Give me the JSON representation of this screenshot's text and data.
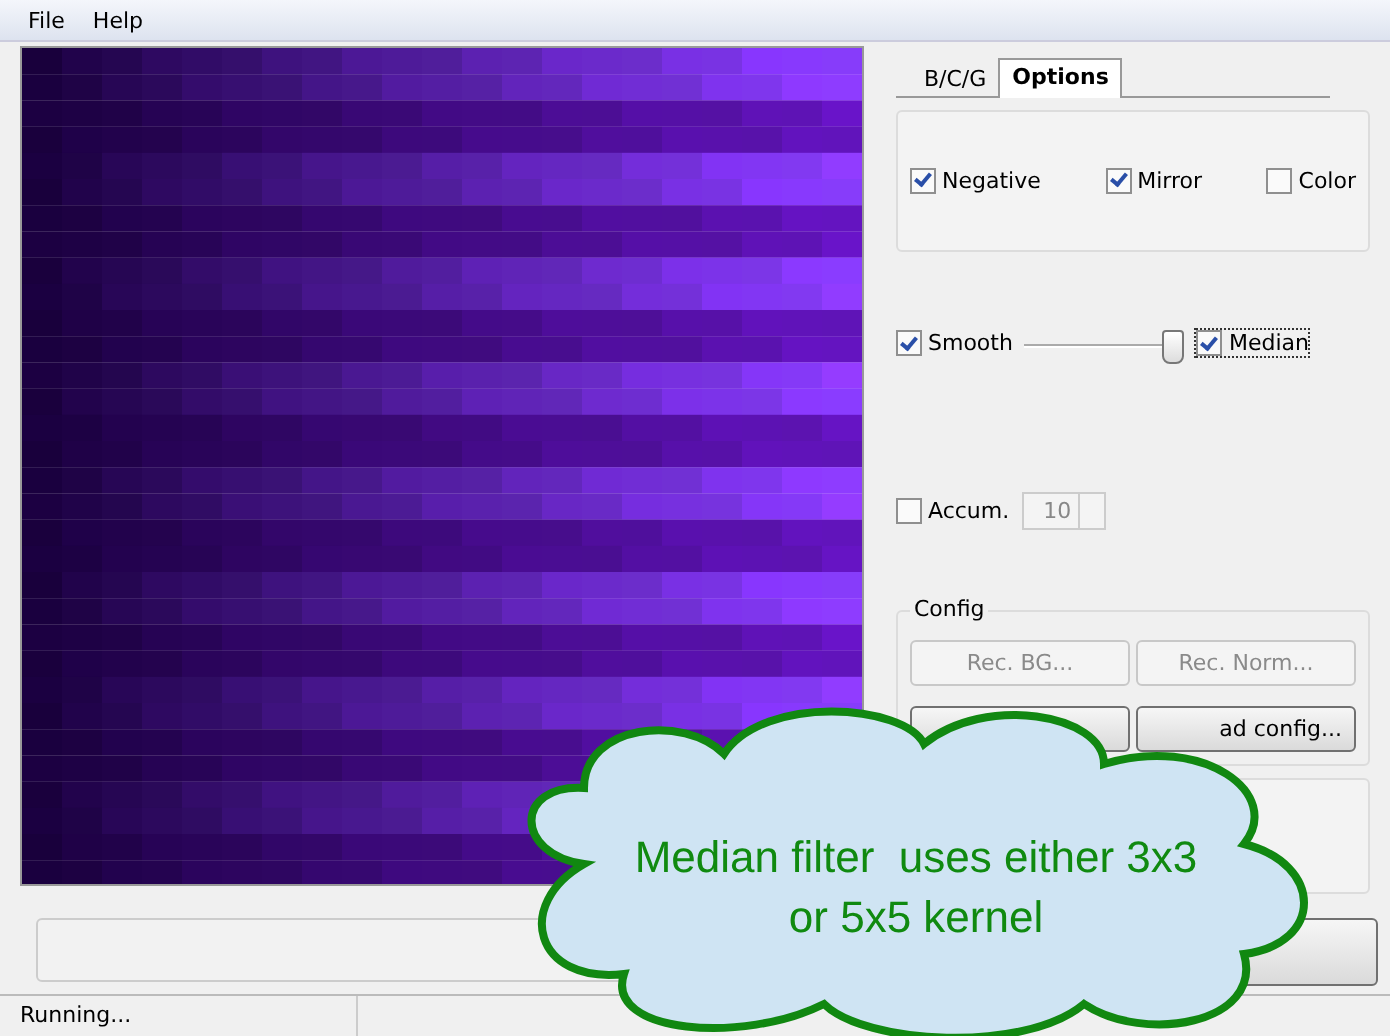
{
  "menu": [
    {
      "label": "File"
    },
    {
      "label": "Help"
    }
  ],
  "tabs": [
    {
      "label": "B/C/G",
      "selected": false
    },
    {
      "label": "Options",
      "selected": true
    }
  ],
  "options": [
    {
      "label": "Negative",
      "checked": true
    },
    {
      "label": "Mirror",
      "checked": true
    },
    {
      "label": "Color",
      "checked": false
    }
  ],
  "smooth": {
    "label": "Smooth",
    "checked": true,
    "level": 1.0
  },
  "median": {
    "label": "Median",
    "checked": true
  },
  "accum": {
    "label": "Accum.",
    "checked": false,
    "value": "10",
    "disabled": true
  },
  "config": {
    "title": "Config",
    "buttons": [
      {
        "label": "Rec. BG...",
        "disabled": true
      },
      {
        "label": "Rec. Norm...",
        "disabled": true
      },
      {
        "label": "ad config...",
        "disabled": false
      }
    ]
  },
  "callout": {
    "lines": [
      "Median filter  uses either 3x3",
      "or 5x5 kernel"
    ]
  },
  "progress": {
    "level": 0
  },
  "status": {
    "text": "Running..."
  }
}
